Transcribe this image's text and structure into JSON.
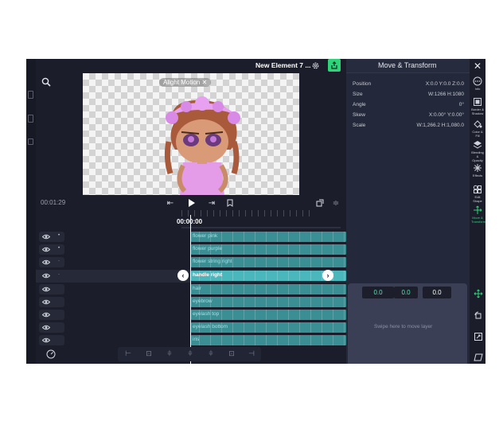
{
  "header": {
    "project_title": "New Element 7 ..."
  },
  "preview": {
    "watermark": "Alight Motion"
  },
  "transport": {
    "time_left": "00:01:29",
    "playhead_time": "00:00:00"
  },
  "tracks": [
    {
      "label": "flower pink",
      "marker": "•"
    },
    {
      "label": "flower purple",
      "marker": "•"
    },
    {
      "label": "flower string right",
      "marker": "·"
    },
    {
      "label": "handle right",
      "marker": "·",
      "selected": true
    },
    {
      "label": "hair",
      "marker": ""
    },
    {
      "label": "eyebrow",
      "marker": ""
    },
    {
      "label": "eyelash top",
      "marker": ""
    },
    {
      "label": "eyelash bottom",
      "marker": ""
    },
    {
      "label": "iris",
      "marker": ""
    }
  ],
  "panel": {
    "title": "Move & Transform",
    "properties": [
      {
        "label": "Position",
        "value": "X:0.0 Y:0.0 Z:0.0"
      },
      {
        "label": "Size",
        "value": "W:1266 H:1080"
      },
      {
        "label": "Angle",
        "value": "0°"
      },
      {
        "label": "Skew",
        "value": "X:0.00° Y:0.00°"
      },
      {
        "label": "Scale",
        "value": "W:1,266.2 H:1,080.0"
      }
    ],
    "values": [
      "0.0",
      "0.0",
      "0.0"
    ],
    "swipe_hint": "Swipe here to move layer"
  },
  "sidebar": {
    "items": [
      {
        "label": "Info",
        "icon": "more-icon"
      },
      {
        "label": "Border & Shadow",
        "icon": "border-icon"
      },
      {
        "label": "Color & Fill",
        "icon": "color-icon"
      },
      {
        "label": "Blending & Opacity",
        "icon": "layers-icon"
      },
      {
        "label": "Effects",
        "icon": "effects-icon"
      },
      {
        "label": "Edit Shape",
        "icon": "shape-icon"
      },
      {
        "label": "Move & Transform",
        "icon": "move-icon",
        "active": true
      }
    ]
  },
  "colors": {
    "accent": "#2ed47a",
    "clip": "#3a8f95",
    "background": "#1b1e2a"
  }
}
